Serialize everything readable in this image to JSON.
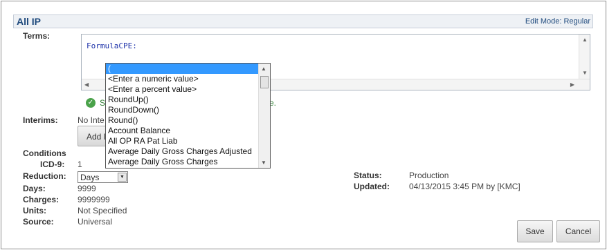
{
  "header": {
    "title": "All IP",
    "mode": "Edit Mode: Regular"
  },
  "terms": {
    "label": "Terms:",
    "code": "FormulaCPE:"
  },
  "validation": {
    "prefix": "S",
    "suffix": "e."
  },
  "dropdown_list": {
    "items": [
      "(",
      "<Enter a numeric value>",
      "<Enter a percent value>",
      "RoundUp()",
      "RoundDown()",
      "Round()",
      "Account Balance",
      "All OP RA Pat Liab",
      "Average Daily Gross Charges Adjusted",
      "Average Daily Gross Charges"
    ],
    "selected_index": 0
  },
  "interims": {
    "label": "Interims:",
    "value": "No Inte",
    "add_button": "Add I"
  },
  "conditions": {
    "label": "Conditions"
  },
  "icd9": {
    "label": "ICD-9:",
    "value": "1"
  },
  "reduction": {
    "label": "Reduction:",
    "value": "Days"
  },
  "days": {
    "label": "Days:",
    "value": "9999"
  },
  "charges": {
    "label": "Charges:",
    "value": "9999999"
  },
  "units": {
    "label": "Units:",
    "value": "Not Specified"
  },
  "source": {
    "label": "Source:",
    "value": "Universal"
  },
  "status": {
    "label": "Status:",
    "value": "Production"
  },
  "updated": {
    "label": "Updated:",
    "value": "04/13/2015 3:45 PM by [KMC]"
  },
  "buttons": {
    "save": "Save",
    "cancel": "Cancel"
  }
}
